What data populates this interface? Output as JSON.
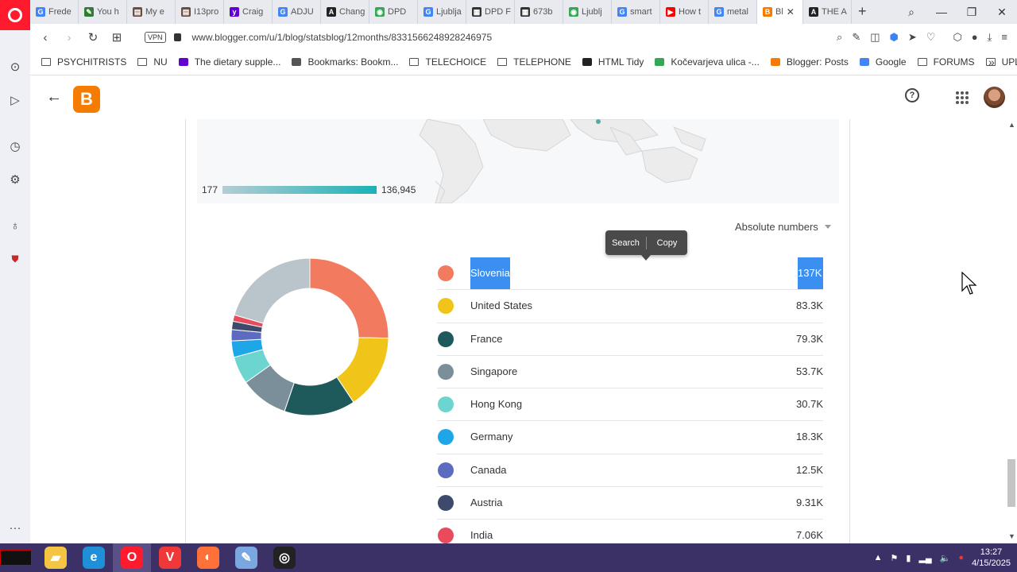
{
  "browser": {
    "tabs": [
      {
        "label": "Frede",
        "favicon": "google-icon",
        "color": "#4285f4",
        "glyph": "G"
      },
      {
        "label": "You h",
        "favicon": "pen-icon",
        "color": "#2e7d32",
        "glyph": "✎"
      },
      {
        "label": "My e",
        "favicon": "folder-icon",
        "color": "#6d4c41",
        "glyph": "▤"
      },
      {
        "label": "I13pro",
        "favicon": "folder-icon",
        "color": "#6d4c41",
        "glyph": "▤"
      },
      {
        "label": "Craig",
        "favicon": "yahoo-icon",
        "color": "#6001d2",
        "glyph": "y"
      },
      {
        "label": "ADJU",
        "favicon": "google-icon",
        "color": "#4285f4",
        "glyph": "G"
      },
      {
        "label": "Chang",
        "favicon": "app-icon",
        "color": "#222",
        "glyph": "A"
      },
      {
        "label": "DPD",
        "favicon": "maps-icon",
        "color": "#34a853",
        "glyph": "◉"
      },
      {
        "label": "Ljublja",
        "favicon": "google-icon",
        "color": "#4285f4",
        "glyph": "G"
      },
      {
        "label": "DPD F",
        "favicon": "grid-icon",
        "color": "#333",
        "glyph": "▦"
      },
      {
        "label": "673b",
        "favicon": "grid-icon",
        "color": "#333",
        "glyph": "▦"
      },
      {
        "label": "Ljublj",
        "favicon": "maps-icon",
        "color": "#34a853",
        "glyph": "◉"
      },
      {
        "label": "smart",
        "favicon": "google-icon",
        "color": "#4285f4",
        "glyph": "G"
      },
      {
        "label": "How t",
        "favicon": "youtube-icon",
        "color": "#ff0000",
        "glyph": "▶"
      },
      {
        "label": "metal",
        "favicon": "google-icon",
        "color": "#4285f4",
        "glyph": "G"
      },
      {
        "label": "Bl",
        "favicon": "blogger-icon",
        "color": "#f57c00",
        "glyph": "B",
        "active": true
      },
      {
        "label": "THE A",
        "favicon": "news-icon",
        "color": "#222",
        "glyph": "A"
      }
    ],
    "url": "www.blogger.com/u/1/blog/statsblog/12months/8331566248928246975",
    "vpn_label": "VPN",
    "bookmarks": [
      {
        "label": "PSYCHITRISTS",
        "icon": "folder-icon"
      },
      {
        "label": "NU",
        "icon": "folder-icon"
      },
      {
        "label": "The dietary supple...",
        "icon": "yahoo-icon",
        "color": "#6001d2"
      },
      {
        "label": "Bookmarks: Bookm...",
        "icon": "heart-icon",
        "color": "#555"
      },
      {
        "label": "TELECHOICE",
        "icon": "folder-icon"
      },
      {
        "label": "TELEPHONE",
        "icon": "folder-icon"
      },
      {
        "label": "HTML Tidy",
        "icon": "chef-icon",
        "color": "#222"
      },
      {
        "label": "Kočevarjeva ulica -...",
        "icon": "maps-icon",
        "color": "#34a853"
      },
      {
        "label": "Blogger: Posts",
        "icon": "blogger-icon",
        "color": "#f57c00"
      },
      {
        "label": "Google",
        "icon": "google-icon",
        "color": "#4285f4"
      },
      {
        "label": "FORUMS",
        "icon": "folder-icon"
      },
      {
        "label": "UPLOAD",
        "icon": "folder-icon"
      }
    ]
  },
  "map_scale": {
    "min": "177",
    "max": "136,945"
  },
  "view_select": {
    "label": "Absolute numbers"
  },
  "context_popup": {
    "search": "Search",
    "copy": "Copy"
  },
  "countries": [
    {
      "name": "Slovenia",
      "value": "137K",
      "color": "#f27a5e",
      "selected": true
    },
    {
      "name": "United States",
      "value": "83.3K",
      "color": "#f0c419"
    },
    {
      "name": "France",
      "value": "79.3K",
      "color": "#1e5a5c"
    },
    {
      "name": "Singapore",
      "value": "53.7K",
      "color": "#7a8f99"
    },
    {
      "name": "Hong Kong",
      "value": "30.7K",
      "color": "#6dd5cf"
    },
    {
      "name": "Germany",
      "value": "18.3K",
      "color": "#1ea7e8"
    },
    {
      "name": "Canada",
      "value": "12.5K",
      "color": "#5c6bc0"
    },
    {
      "name": "Austria",
      "value": "9.31K",
      "color": "#3e4a6b"
    },
    {
      "name": "India",
      "value": "7.06K",
      "color": "#e94a5c"
    }
  ],
  "donut_other": {
    "value_fraction": 0.205,
    "color": "#b9c4cb"
  },
  "taskbar": {
    "apps": [
      {
        "name": "file-explorer-icon",
        "color": "#f4c542",
        "glyph": "▰"
      },
      {
        "name": "edge-icon",
        "color": "#1f8fd8",
        "glyph": "e"
      },
      {
        "name": "opera-icon",
        "color": "#ff1b2d",
        "glyph": "O",
        "active": true
      },
      {
        "name": "vivaldi-icon",
        "color": "#ef3939",
        "glyph": "V"
      },
      {
        "name": "firefox-icon",
        "color": "#ff7139",
        "glyph": "◐"
      },
      {
        "name": "paint-icon",
        "color": "#7aa7e0",
        "glyph": "✎"
      },
      {
        "name": "obs-icon",
        "color": "#222",
        "glyph": "◎"
      }
    ],
    "time": "13:27",
    "date": "4/15/2025"
  }
}
